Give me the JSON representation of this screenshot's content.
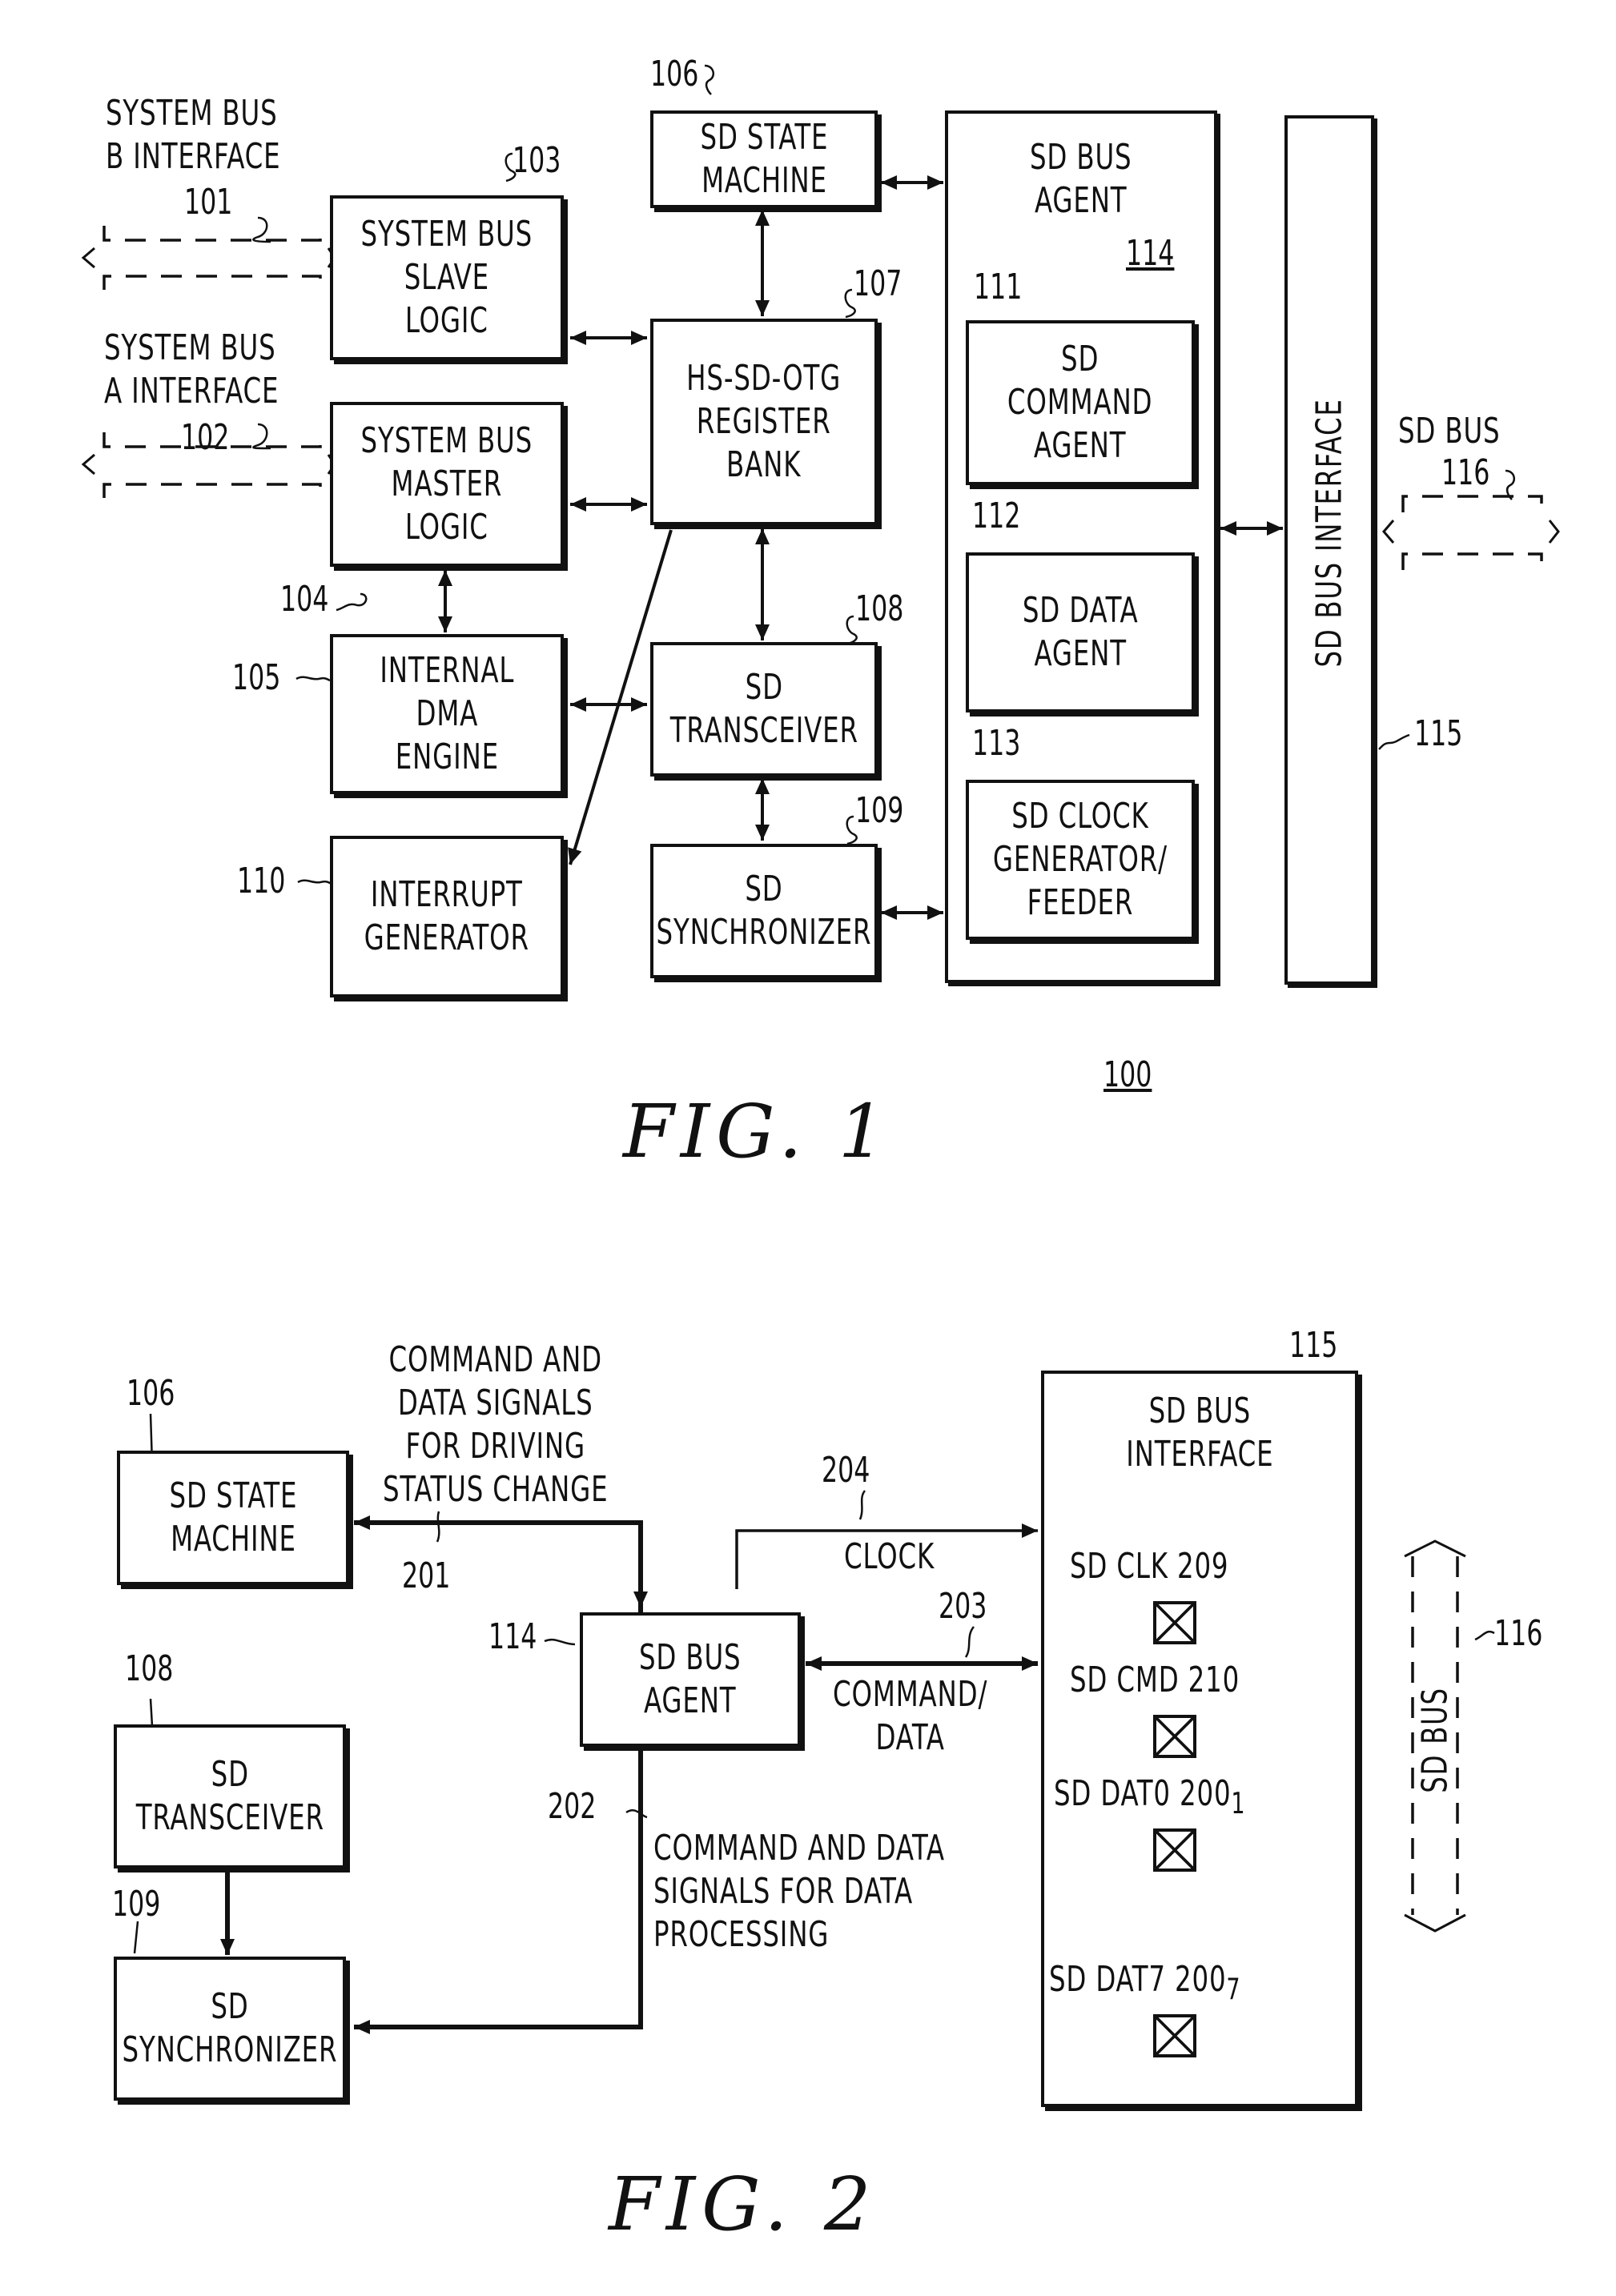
{
  "fig1": {
    "caption": "FIG. 1",
    "system_ref": "100",
    "sys_bus_b_label": "SYSTEM BUS\nB INTERFACE",
    "sys_bus_a_label": "SYSTEM BUS\nA INTERFACE",
    "sd_bus_label": "SD BUS",
    "blocks": {
      "slave_logic": {
        "label": "SYSTEM BUS\nSLAVE\nLOGIC",
        "ref": "103"
      },
      "master_logic": {
        "label": "SYSTEM BUS\nMASTER\nLOGIC",
        "ref": "104"
      },
      "dma_engine": {
        "label": "INTERNAL\nDMA\nENGINE",
        "ref": "105"
      },
      "interrupt_gen": {
        "label": "INTERRUPT\nGENERATOR",
        "ref": "110"
      },
      "state_machine": {
        "label": "SD STATE\nMACHINE",
        "ref": "106"
      },
      "register_bank": {
        "label": "HS-SD-OTG\nREGISTER\nBANK",
        "ref": "107"
      },
      "transceiver": {
        "label": "SD\nTRANSCEIVER",
        "ref": "108"
      },
      "synchronizer": {
        "label": "SD\nSYNCHRONIZER",
        "ref": "109"
      },
      "bus_agent": {
        "label": "SD BUS\nAGENT",
        "ref": "114"
      },
      "command_agent": {
        "label": "SD\nCOMMAND\nAGENT",
        "ref": "111"
      },
      "data_agent": {
        "label": "SD DATA\nAGENT",
        "ref": "112"
      },
      "clock_gen": {
        "label": "SD CLOCK\nGENERATOR/\nFEEDER",
        "ref": "113"
      },
      "bus_interface": {
        "label": "SD BUS INTERFACE",
        "ref": "115"
      }
    },
    "refs": {
      "bus_b": "101",
      "bus_a": "102",
      "sd_bus": "116"
    }
  },
  "fig2": {
    "caption": "FIG. 2",
    "blocks": {
      "state_machine": {
        "label": "SD STATE\nMACHINE",
        "ref": "106"
      },
      "transceiver": {
        "label": "SD\nTRANSCEIVER",
        "ref": "108"
      },
      "synchronizer": {
        "label": "SD\nSYNCHRONIZER",
        "ref": "109"
      },
      "bus_agent": {
        "label": "SD BUS\nAGENT",
        "ref": "114"
      },
      "bus_interface": {
        "label": "SD BUS\nINTERFACE",
        "ref": "115"
      }
    },
    "signals": {
      "status_change": {
        "label": "COMMAND AND\nDATA SIGNALS\nFOR DRIVING\nSTATUS CHANGE",
        "ref": "201"
      },
      "data_processing": {
        "label": "COMMAND AND DATA\nSIGNALS FOR DATA\nPROCESSING",
        "ref": "202"
      },
      "command_data": {
        "label": "COMMAND/\nDATA",
        "ref": "203"
      },
      "clock": {
        "label": "CLOCK",
        "ref": "204"
      }
    },
    "pins": [
      {
        "label": "SD  CLK  209"
      },
      {
        "label": "SD  CMD  210"
      },
      {
        "label": "SD  DAT0  200",
        "sub": "1"
      },
      {
        "label": "SD  DAT7  200",
        "sub": "7"
      }
    ],
    "sd_bus_label": "SD BUS",
    "sd_bus_ref": "116"
  }
}
